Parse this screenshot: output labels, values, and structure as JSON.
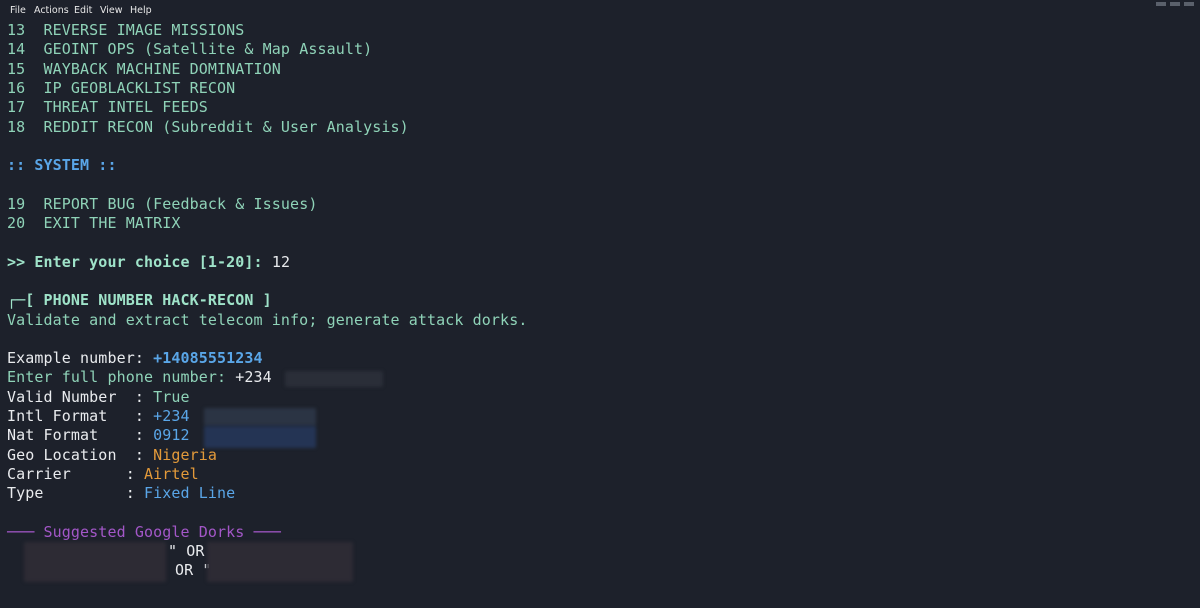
{
  "menubar": {
    "file": "File",
    "actions": "Actions",
    "edit": "Edit",
    "view": "View",
    "help": "Help"
  },
  "menu_items": [
    {
      "num": "13",
      "label": "REVERSE IMAGE MISSIONS"
    },
    {
      "num": "14",
      "label": "GEOINT OPS (Satellite & Map Assault)"
    },
    {
      "num": "15",
      "label": "WAYBACK MACHINE DOMINATION"
    },
    {
      "num": "16",
      "label": "IP GEOBLACKLIST RECON"
    },
    {
      "num": "17",
      "label": "THREAT INTEL FEEDS"
    },
    {
      "num": "18",
      "label": "REDDIT RECON (Subreddit & User Analysis)"
    }
  ],
  "system_header": ":: SYSTEM ::",
  "system_items": [
    {
      "num": "19",
      "label": "REPORT BUG (Feedback & Issues)"
    },
    {
      "num": "20",
      "label": "EXIT THE MATRIX"
    }
  ],
  "prompt": {
    "text": ">> Enter your choice [1-20]:",
    "value": "12"
  },
  "module": {
    "title": "┌─[ PHONE NUMBER HACK-RECON ]",
    "description": "Validate and extract telecom info; generate attack dorks.",
    "example_label": "Example number: ",
    "example_value": "+14085551234",
    "input_label": "Enter full phone number: ",
    "input_value": "+234"
  },
  "results": [
    {
      "key": "Valid Number  : ",
      "value": "True"
    },
    {
      "key": "Intl Format   : ",
      "value": "+234"
    },
    {
      "key": "Nat Format    : ",
      "value": "0912"
    },
    {
      "key": "Geo Location  : ",
      "value": "Nigeria"
    },
    {
      "key": "Carrier      : ",
      "value": "Airtel"
    },
    {
      "key": "Type         : ",
      "value": "Fixed Line"
    }
  ],
  "dorks": {
    "header": "─── Suggested Google Dorks ───",
    "line1": "\" OR",
    "line2": "OR \""
  }
}
